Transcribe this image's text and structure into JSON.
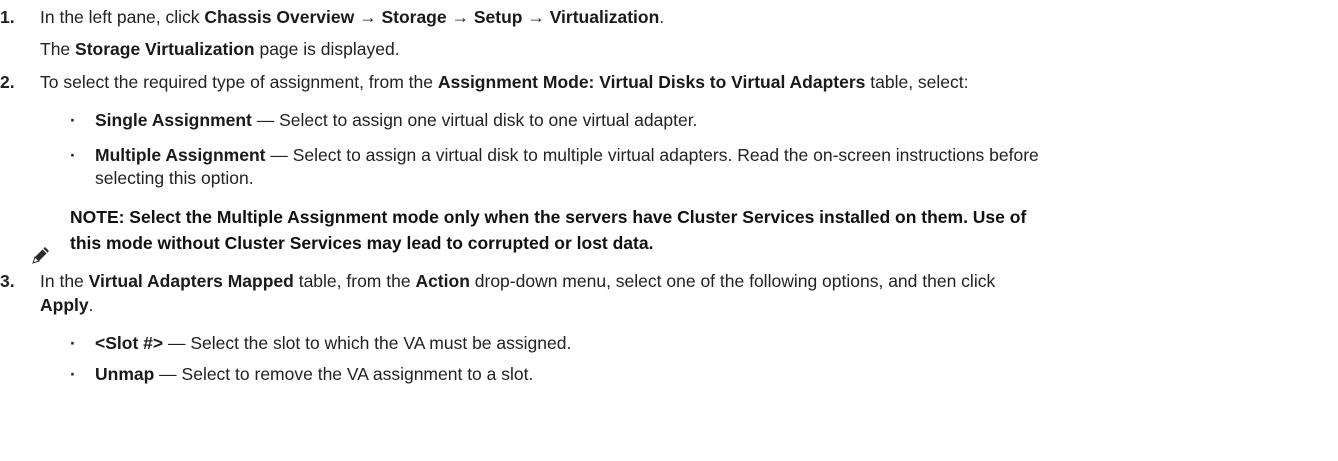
{
  "steps": [
    {
      "number": "1.",
      "parts": [
        "In the left pane, click ",
        "Chassis Overview",
        " → ",
        "Storage",
        " → ",
        "Setup",
        " → ",
        "Virtualization",
        "."
      ],
      "result_parts": [
        "The ",
        "Storage Virtualization",
        " page is displayed."
      ]
    },
    {
      "number": "2.",
      "parts": [
        "To select the required type of assignment, from the ",
        "Assignment Mode: Virtual Disks to Virtual Adapters",
        " table, select:"
      ],
      "options": [
        {
          "bullet": "·",
          "label": "Single Assignment",
          "desc": " — Select to assign one virtual disk to one virtual adapter."
        },
        {
          "bullet": "·",
          "label": "Multiple Assignment",
          "desc": " — Select to assign a virtual disk to multiple virtual adapters. Read the on-screen instructions before",
          "desc_cont": "selecting this option."
        }
      ],
      "note": {
        "icon": "pencil-note-icon",
        "line1": "NOTE: Select the Multiple Assignment mode only when the servers have Cluster Services installed on them. Use of",
        "line2": "this mode without Cluster Services may lead to corrupted or lost data."
      }
    },
    {
      "number": "3.",
      "parts": [
        "In the ",
        "Virtual Adapters Mapped",
        " table, from the ",
        "Action",
        " drop-down menu, select one of the following options, and then click"
      ],
      "parts_cont": [
        "Apply",
        "."
      ],
      "options": [
        {
          "bullet": "·",
          "label": "<Slot #>",
          "desc": " — Select the slot to which the VA must be assigned."
        },
        {
          "bullet": "·",
          "label": "Unmap",
          "desc": " — Select to remove the VA assignment to a slot."
        }
      ]
    }
  ],
  "colors": {
    "text": "#222222",
    "bold": "#1a1a1a",
    "icon": "#2b2b2b"
  }
}
